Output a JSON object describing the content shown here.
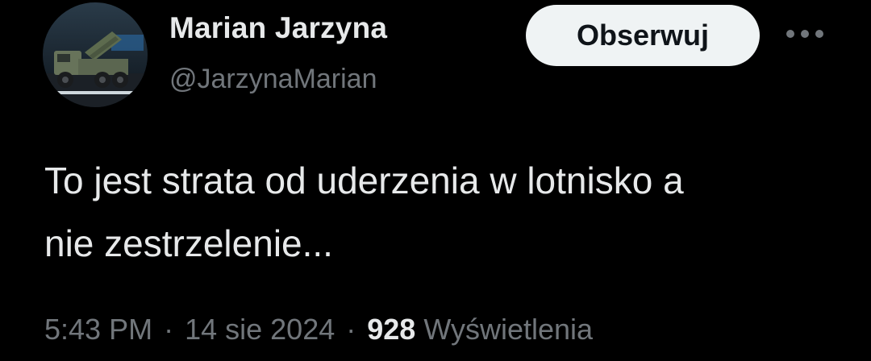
{
  "author": {
    "display_name": "Marian Jarzyna",
    "handle": "@JarzynaMarian",
    "avatar": "avatar-photo-military-rocket-launcher-truck"
  },
  "actions": {
    "follow_label": "Obserwuj",
    "more_icon": "more-dots-icon"
  },
  "tweet": {
    "text": "To jest strata od uderzenia w lotnisko a\nnie zestrzelenie..."
  },
  "meta": {
    "time": "5:43 PM",
    "separator": "·",
    "date": "14 sie 2024",
    "views_count": "928",
    "views_label": "Wyświetlenia"
  },
  "colors": {
    "background": "#000000",
    "primary_text": "#e7e9ea",
    "secondary_text": "#71767b",
    "button_bg": "#eff3f4",
    "button_text": "#0f1419"
  }
}
